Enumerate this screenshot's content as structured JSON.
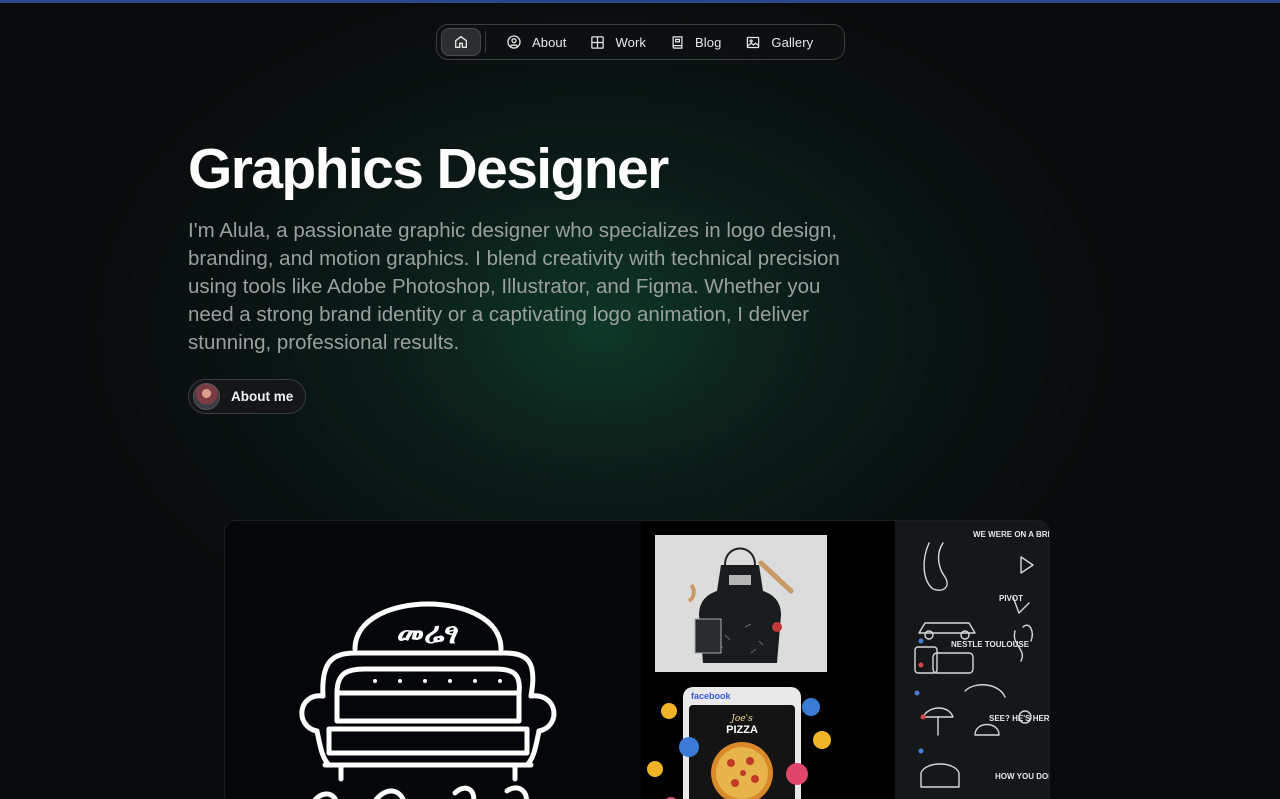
{
  "nav": {
    "home_icon": "home-icon",
    "items": [
      {
        "label": "About",
        "icon": "user-circle-icon"
      },
      {
        "label": "Work",
        "icon": "grid-icon"
      },
      {
        "label": "Blog",
        "icon": "book-icon"
      },
      {
        "label": "Gallery",
        "icon": "image-icon"
      }
    ]
  },
  "hero": {
    "title": "Graphics Designer",
    "description": "I'm Alula, a passionate graphic designer who specializes in logo design, branding, and motion graphics. I blend creativity with technical precision using tools like Adobe Photoshop, Illustrator, and Figma. Whether you need a strong brand identity or a captivating logo animation, I deliver stunning, professional results.",
    "about_button": "About me"
  },
  "showcase": {
    "logo_text": "መሬፃ",
    "fb_label": "facebook",
    "pizza_label_script": "Joe's",
    "pizza_label": "PIZZA",
    "doodle_texts": [
      "WE WERE ON A BREAK",
      "PIVOT",
      "NESTLE TOULOUSE",
      "SEE? HE'S HER LOBSTER",
      "HOW YOU DOIN'?"
    ]
  },
  "colors": {
    "background": "#0a0b0c",
    "glow": "#125c40",
    "top_strip": "#2a4a8a",
    "description_text": "#9aa09d"
  }
}
